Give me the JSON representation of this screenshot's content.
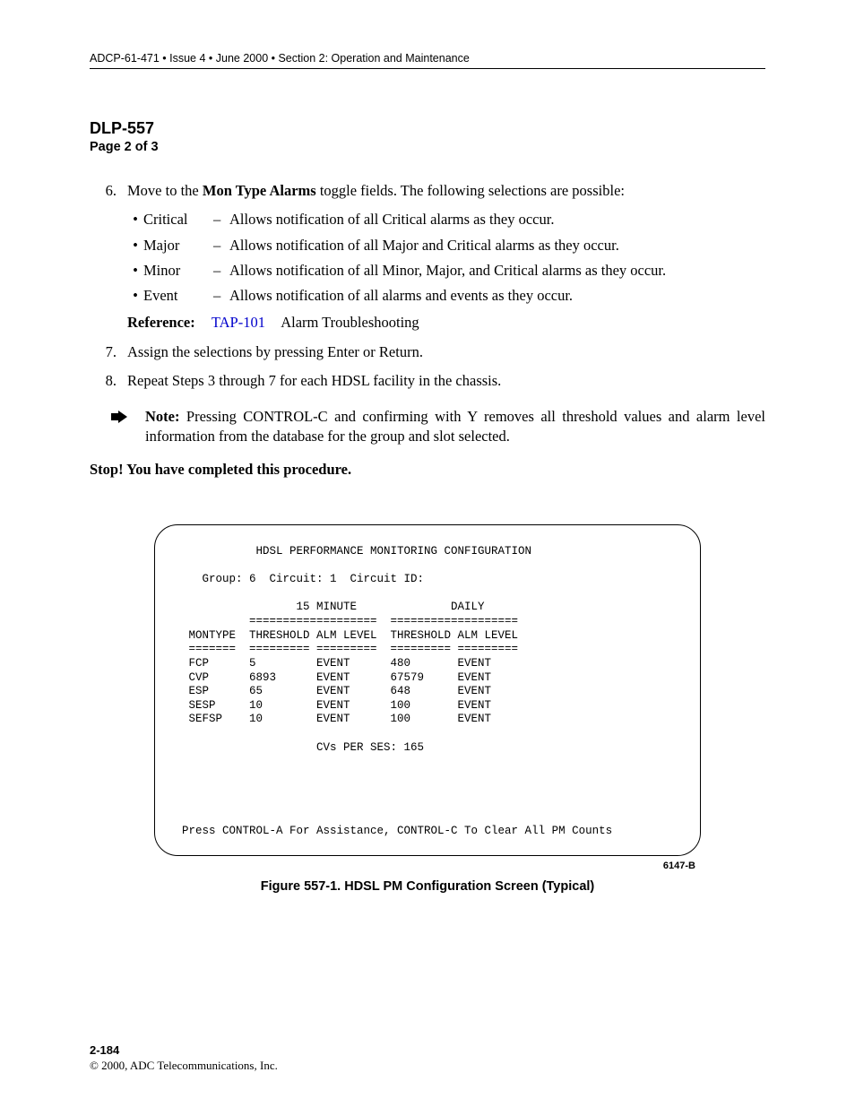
{
  "header": "ADCP-61-471 • Issue 4 • June 2000 • Section 2: Operation and Maintenance",
  "dlp": "DLP-557",
  "page_of": "Page 2 of 3",
  "steps": {
    "s6_num": "6.",
    "s6_pre": "Move to the ",
    "s6_bold": "Mon Type Alarms",
    "s6_post": " toggle fields. The following selections are possible:",
    "bullets": [
      {
        "name": "Critical",
        "dash": "–",
        "desc": "Allows notification of all Critical alarms as they occur."
      },
      {
        "name": "Major",
        "dash": "–",
        "desc": "Allows notification of all Major and Critical alarms as they occur."
      },
      {
        "name": "Minor",
        "dash": "–",
        "desc": "Allows notification of all Minor, Major, and Critical alarms as they occur."
      },
      {
        "name": "Event",
        "dash": "–",
        "desc": "Allows notification of all alarms and events as they occur."
      }
    ],
    "ref_label": "Reference:",
    "ref_link": "TAP-101",
    "ref_text": "Alarm Troubleshooting",
    "s7_num": "7.",
    "s7_text": "Assign the selections by pressing Enter or Return.",
    "s8_num": "8.",
    "s8_text": "Repeat Steps 3 through 7 for each HDSL facility in the chassis.",
    "note_label": "Note:",
    "note_text": " Pressing CONTROL-C and confirming with Y removes all threshold values and alarm level information from the database for the group and slot selected.",
    "stop": "Stop! You have completed this procedure."
  },
  "terminal": {
    "title": "           HDSL PERFORMANCE MONITORING CONFIGURATION",
    "group": "   Group: 6  Circuit: 1  Circuit ID:",
    "hdr1": "                 15 MINUTE              DAILY",
    "hdr2": "          ===================  ===================",
    "hdr3": " MONTYPE  THRESHOLD ALM LEVEL  THRESHOLD ALM LEVEL",
    "hdr4": " =======  ========= =========  ========= =========",
    "r1": " FCP      5         EVENT      480       EVENT",
    "r2": " CVP      6893      EVENT      67579     EVENT",
    "r3": " ESP      65        EVENT      648       EVENT",
    "r4": " SESP     10        EVENT      100       EVENT",
    "r5": " SEFSP    10        EVENT      100       EVENT",
    "cvs": "                    CVs PER SES: 165",
    "foot": "Press CONTROL-A For Assistance, CONTROL-C To Clear All PM Counts"
  },
  "fig_code": "6147-B",
  "fig_caption": "Figure 557-1. HDSL PM Configuration Screen (Typical)",
  "footer_page": "2-184",
  "footer_copy": "© 2000, ADC Telecommunications, Inc."
}
